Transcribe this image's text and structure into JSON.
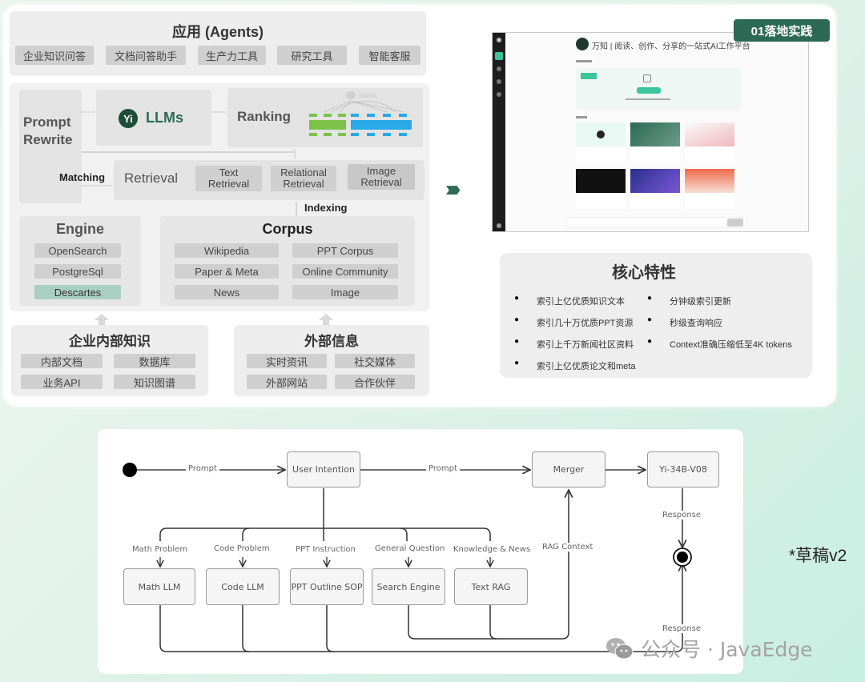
{
  "colors": {
    "brand_green": "#2d6a55",
    "chip_gray": "#cfcfcf",
    "chip_teal": "#a9cfc3",
    "ranking_green": "#7cc24a",
    "ranking_blue": "#29a9e8"
  },
  "architecture": {
    "agents": {
      "title": "应用 (Agents)",
      "items": [
        "企业知识问答",
        "文档问答助手",
        "生产力工具",
        "研究工具",
        "智能客服"
      ]
    },
    "prompt_rewrite": "Prompt Rewrite",
    "llms": {
      "icon": "yi-logo-icon",
      "label": "LLMs"
    },
    "ranking": "Ranking",
    "matching": "Matching",
    "retrieval": {
      "title": "Retrieval",
      "items": [
        "Text Retrieval",
        "Relational Retrieval",
        "Image Retrieval"
      ]
    },
    "indexing": "Indexing",
    "engine": {
      "title": "Engine",
      "items": [
        "OpenSearch",
        "PostgreSql",
        "Descartes"
      ]
    },
    "corpus": {
      "title": "Corpus",
      "items": [
        "Wikipedia",
        "PPT Corpus",
        "Paper & Meta",
        "Online Community",
        "News",
        "Image"
      ]
    },
    "internal_knowledge": {
      "title": "企业内部知识",
      "items": [
        "内部文档",
        "数据库",
        "业务API",
        "知识图谱"
      ]
    },
    "external_info": {
      "title": "外部信息",
      "items": [
        "实时资讯",
        "社交媒体",
        "外部网站",
        "合作伙伴"
      ]
    }
  },
  "practice": {
    "badge": "01落地实践",
    "arrows": "››››",
    "app_title": "万知 | 阅读、创作、分享的一站式AI工作平台"
  },
  "features": {
    "title": "核心特性",
    "left": [
      "索引上亿优质知识文本",
      "索引几十万优质PPT资源",
      "索引上千万新闻社区资料",
      "索引上亿优质论文和meta"
    ],
    "right": [
      "分钟级索引更新",
      "秒级查询响应",
      "Context准确压缩低至4K tokens"
    ]
  },
  "flow": {
    "nodes": {
      "user_intention": "User Intention",
      "merger": "Merger",
      "model": "Yi-34B-V08",
      "math_llm": "Math LLM",
      "code_llm": "Code LLM",
      "ppt_outline": "PPT Outline SOP",
      "search_engine": "Search Engine",
      "text_rag": "Text RAG"
    },
    "edges": {
      "prompt_1": "Prompt",
      "prompt_2": "Prompt",
      "math_problem": "Math Problem",
      "code_problem": "Code Problem",
      "ppt_instruction": "PPT Instruction",
      "general_question": "General Question",
      "knowledge_news": "Knowledge & News",
      "rag_context": "RAG Context",
      "response_top": "Response",
      "response_bottom": "Response"
    }
  },
  "draft_label": "*草稿v2",
  "watermark": "公众号 · JavaEdge"
}
